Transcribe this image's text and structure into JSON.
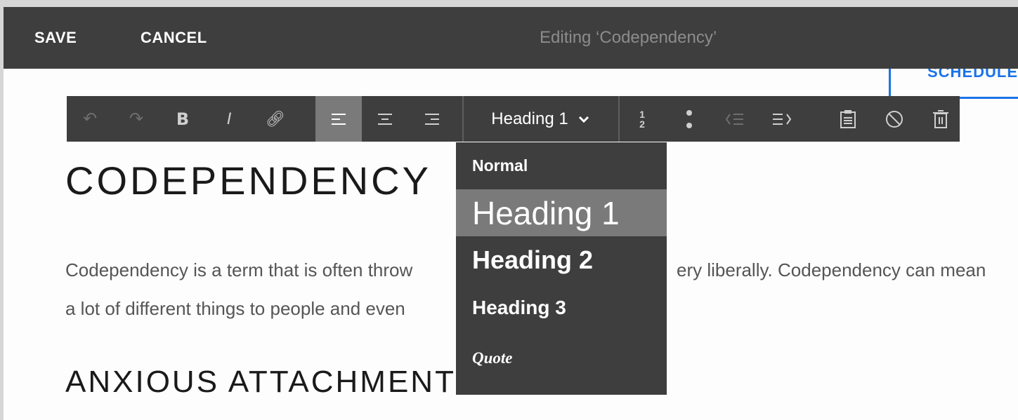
{
  "topbar": {
    "save": "SAVE",
    "cancel": "CANCEL",
    "title": "Editing ‘Codependency’"
  },
  "schedule_label": "SCHEDULE",
  "toolbar": {
    "format_value": "Heading 1",
    "icons": [
      "undo-icon",
      "redo-icon",
      "bold-icon",
      "italic-icon",
      "link-icon",
      "align-left-icon",
      "align-center-icon",
      "align-right-icon",
      "ordered-list-icon",
      "bullet-list-icon",
      "outdent-icon",
      "indent-icon",
      "paste-icon",
      "clear-format-icon",
      "delete-icon"
    ]
  },
  "content": {
    "title": "CODEPENDENCY",
    "para_line1_a": "Codependency is a term that is often throw",
    "para_line1_b": "ery liberally. Codependency can mean",
    "para_line2": "a lot of different things to people and even",
    "heading2": "ANXIOUS ATTACHMENT"
  },
  "dropdown": {
    "options": [
      "Normal",
      "Heading 1",
      "Heading 2",
      "Heading 3",
      "Quote"
    ],
    "selected": "Heading 1"
  },
  "colors": {
    "bar": "#3e3e3e",
    "highlight": "#7a7a7a",
    "accent": "#1a73e8"
  }
}
